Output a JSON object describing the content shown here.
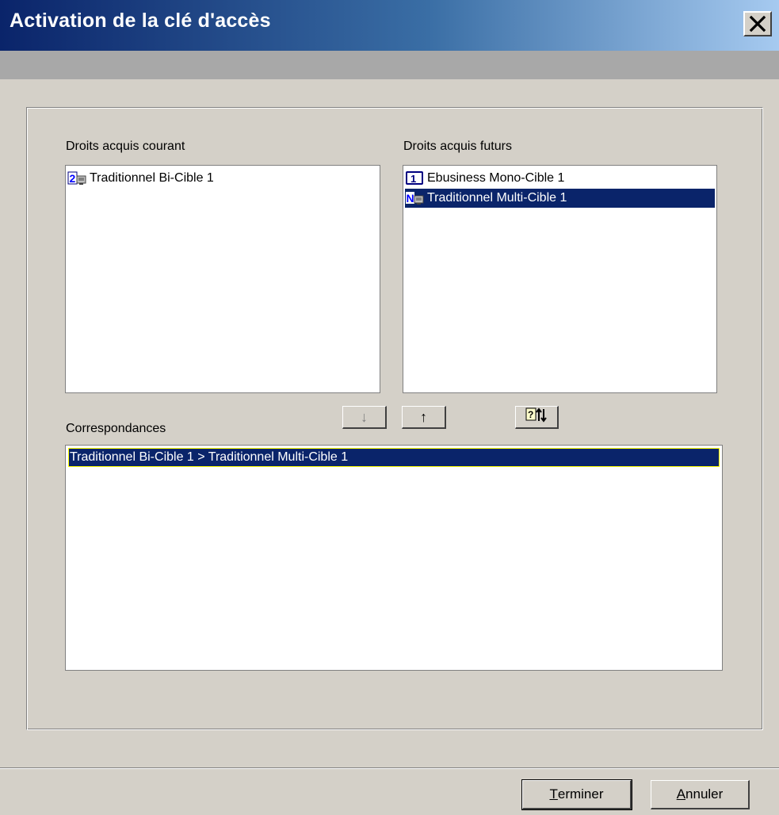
{
  "window": {
    "title": "Activation de la clé d'accès"
  },
  "current_rights": {
    "label": "Droits acquis courant",
    "items": [
      {
        "label": "Traditionnel Bi-Cible 1",
        "icon": "bi-cible-2-icon",
        "selected": false
      }
    ]
  },
  "future_rights": {
    "label": "Droits acquis futurs",
    "items": [
      {
        "label": "Ebusiness Mono-Cible 1",
        "icon": "mono-cible-1-icon",
        "selected": false
      },
      {
        "label": "Traditionnel Multi-Cible 1",
        "icon": "multi-cible-n-icon",
        "selected": true
      }
    ]
  },
  "transfer_buttons": {
    "down_arrow": "↓",
    "up_arrow": "↑",
    "swap_icon": "swap-help-icon"
  },
  "mappings": {
    "label": "Correspondances",
    "items": [
      {
        "label": "Traditionnel Bi-Cible 1 > Traditionnel Multi-Cible 1",
        "selected": true
      }
    ]
  },
  "footer": {
    "finish_mnemonic": "T",
    "finish_rest": "erminer",
    "cancel_mnemonic": "A",
    "cancel_rest": "nnuler"
  },
  "colors": {
    "selection": "#0a246a",
    "dialog_bg": "#d4d0c8",
    "title_gradient_start": "#0a246a",
    "title_gradient_end": "#a6caf0"
  }
}
